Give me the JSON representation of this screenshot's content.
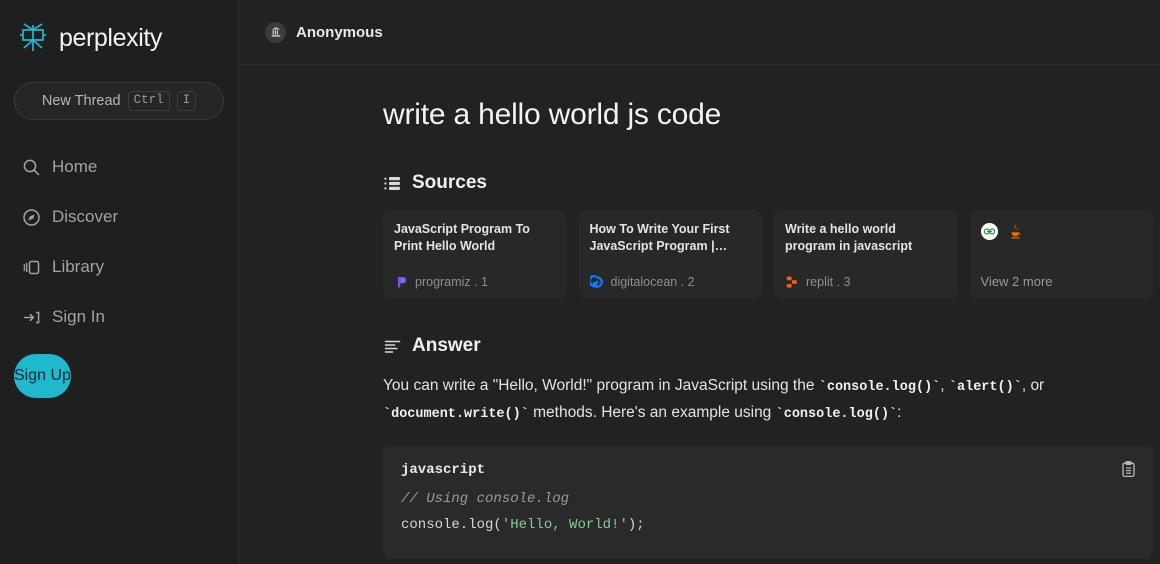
{
  "sidebar": {
    "brand": "perplexity",
    "new_thread": {
      "label": "New Thread",
      "key_mod": "Ctrl",
      "key_letter": "I"
    },
    "nav": [
      {
        "label": "Home",
        "icon": "search-icon"
      },
      {
        "label": "Discover",
        "icon": "compass-icon"
      },
      {
        "label": "Library",
        "icon": "library-icon"
      },
      {
        "label": "Sign In",
        "icon": "sign-in-icon"
      }
    ],
    "signup_label": "Sign Up"
  },
  "topbar": {
    "user": "Anonymous",
    "avatar_icon": "bank-building-icon"
  },
  "main": {
    "question": "write a hello world js code",
    "sources": {
      "heading": "Sources",
      "icon": "sources-list-icon",
      "cards": [
        {
          "title": "JavaScript Program To Print Hello World",
          "domain": "programiz",
          "index": "1",
          "favicon": "programiz-icon"
        },
        {
          "title": "How To Write Your First JavaScript Program |…",
          "domain": "digitalocean",
          "index": "2",
          "favicon": "digitalocean-icon"
        },
        {
          "title": "Write a hello world program in javascript",
          "domain": "replit",
          "index": "3",
          "favicon": "replit-icon"
        }
      ],
      "more_card": {
        "label": "View 2 more",
        "icons": [
          "geeksforgeeks-icon",
          "java-icon"
        ]
      }
    },
    "answer": {
      "heading": "Answer",
      "icon": "answer-lines-icon",
      "text_1": "You can write a \"Hello, World!\" program in JavaScript using the ",
      "code_1": "`console.log()`",
      "text_2": ", ",
      "code_2": "`alert()`",
      "text_3": ", or ",
      "code_3": "`document.write()`",
      "text_4": " methods. Here's an example using ",
      "code_4": "`console.log()`",
      "text_5": ":",
      "code_block": {
        "language": "javascript",
        "comment": "// Using console.log",
        "line_prefix": "console.log(",
        "string": "'Hello, World!'",
        "line_suffix": ");",
        "copy_icon": "clipboard-copy-icon"
      }
    }
  },
  "colors": {
    "accent": "#20b8cd",
    "sidebar_bg": "#1f1f1f",
    "main_bg": "#222222",
    "card_bg": "#282828",
    "code_bg": "#2a2a2a",
    "string_green": "#87c997"
  }
}
